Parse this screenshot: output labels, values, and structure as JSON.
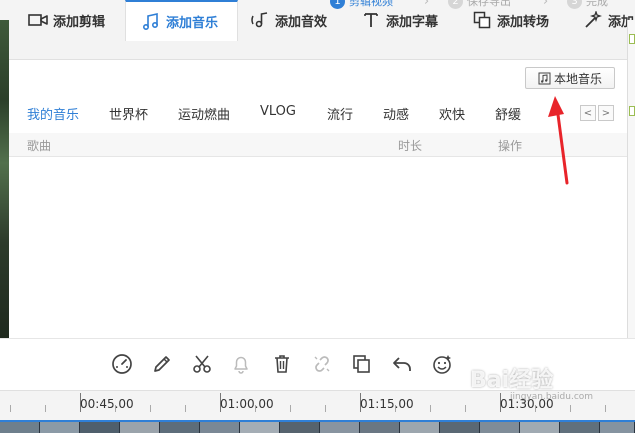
{
  "steps": [
    {
      "num": "1",
      "label": "剪辑视频"
    },
    {
      "num": "2",
      "label": "保存导出"
    },
    {
      "num": "3",
      "label": "完成"
    }
  ],
  "tabs": [
    {
      "label": "添加剪辑",
      "icon": "camera-icon"
    },
    {
      "label": "添加音乐",
      "icon": "music-note-icon"
    },
    {
      "label": "添加音效",
      "icon": "sound-effect-icon"
    },
    {
      "label": "添加字幕",
      "icon": "text-icon"
    },
    {
      "label": "添加转场",
      "icon": "transition-icon"
    },
    {
      "label": "添加",
      "icon": "magic-wand-icon"
    }
  ],
  "music": {
    "local_button": "本地音乐",
    "categories": [
      "我的音乐",
      "世界杯",
      "运动燃曲",
      "VLOG",
      "流行",
      "动感",
      "欢快",
      "舒缓"
    ],
    "active_category": "我的音乐",
    "prev": "<",
    "next": ">",
    "columns": {
      "song": "歌曲",
      "duration": "时长",
      "action": "操作"
    }
  },
  "toolbar": [
    "speed-icon",
    "pencil-icon",
    "scissors-icon",
    "bell-icon",
    "trash-icon",
    "unlink-icon",
    "copy-icon",
    "undo-icon",
    "emoji-icon"
  ],
  "timeline": {
    "labels": [
      "00:45.00",
      "01:00.00",
      "01:15.00",
      "01:30.00"
    ]
  },
  "watermark": {
    "text": "Bai经验",
    "sub": "jingyan.baidu.com"
  },
  "colors": {
    "accent": "#2f7fd6",
    "annotation": "#e8242a"
  }
}
